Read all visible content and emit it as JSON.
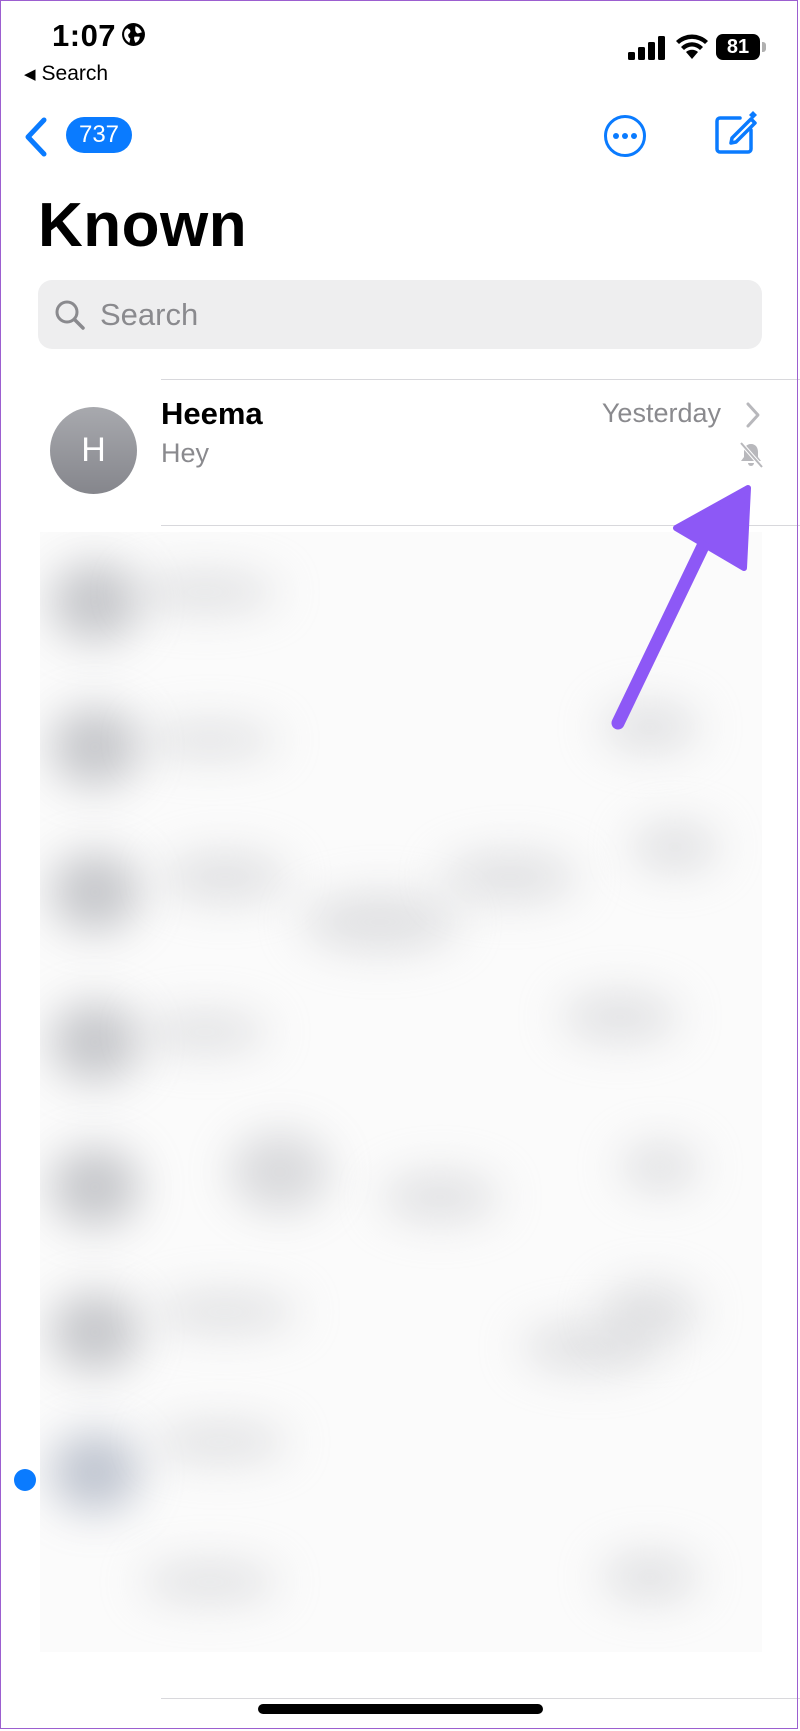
{
  "status_bar": {
    "time": "1:07",
    "back_to_app": "Search",
    "battery": "81"
  },
  "nav": {
    "back_count": "737",
    "title": "Known"
  },
  "search": {
    "placeholder": "Search"
  },
  "conversations": [
    {
      "initial": "H",
      "name": "Heema",
      "preview": "Hey",
      "date": "Yesterday",
      "muted": true
    }
  ],
  "colors": {
    "accent": "#0a7bff",
    "annotation_arrow": "#8d58f6",
    "secondary_text": "#8a8a8e"
  },
  "icons": [
    "globe-icon",
    "back-chevron-icon",
    "signal-icon",
    "wifi-icon",
    "battery-icon",
    "more-icon",
    "compose-icon",
    "search-icon",
    "chevron-right-icon",
    "bell-slash-icon"
  ]
}
